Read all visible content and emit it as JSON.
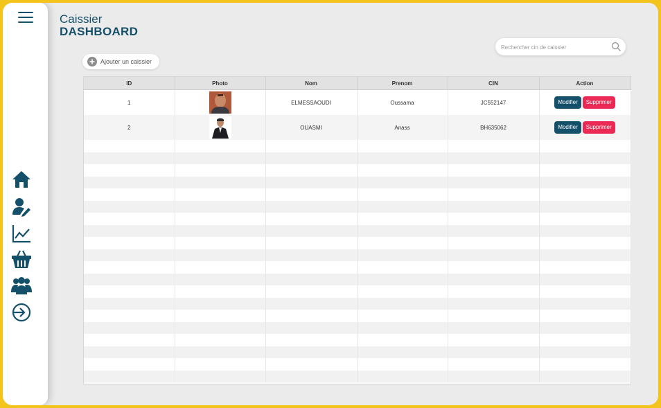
{
  "header": {
    "title_small": "Caissier",
    "title_big": "DASHBOARD"
  },
  "search": {
    "placeholder": "Rechercher cin de caissier",
    "icon": "search-icon"
  },
  "add_button": {
    "label": "Ajouter un caissier",
    "icon": "plus-circle-icon"
  },
  "sidebar": {
    "menu_icon": "hamburger-menu-icon",
    "items": [
      {
        "name": "home",
        "icon": "home-icon"
      },
      {
        "name": "user-edit",
        "icon": "user-edit-icon"
      },
      {
        "name": "statistics",
        "icon": "chart-line-icon"
      },
      {
        "name": "basket",
        "icon": "basket-icon"
      },
      {
        "name": "users",
        "icon": "users-icon"
      },
      {
        "name": "logout",
        "icon": "sign-in-icon"
      }
    ]
  },
  "table": {
    "columns": [
      "ID",
      "Photo",
      "Nom",
      "Prenom",
      "CIN",
      "Action"
    ],
    "rows": [
      {
        "id": "1",
        "nom": "ELMESSAOUDI",
        "prenom": "Oussama",
        "cin": "JC552147",
        "modifier": "Modifier",
        "supprimer": "Supprimer"
      },
      {
        "id": "2",
        "nom": "OUASMI",
        "prenom": "Anass",
        "cin": "BH635062",
        "modifier": "Modifier",
        "supprimer": "Supprimer"
      }
    ]
  },
  "colors": {
    "primary": "#15506a",
    "danger": "#ea2a54",
    "frame": "#f2c41c"
  }
}
